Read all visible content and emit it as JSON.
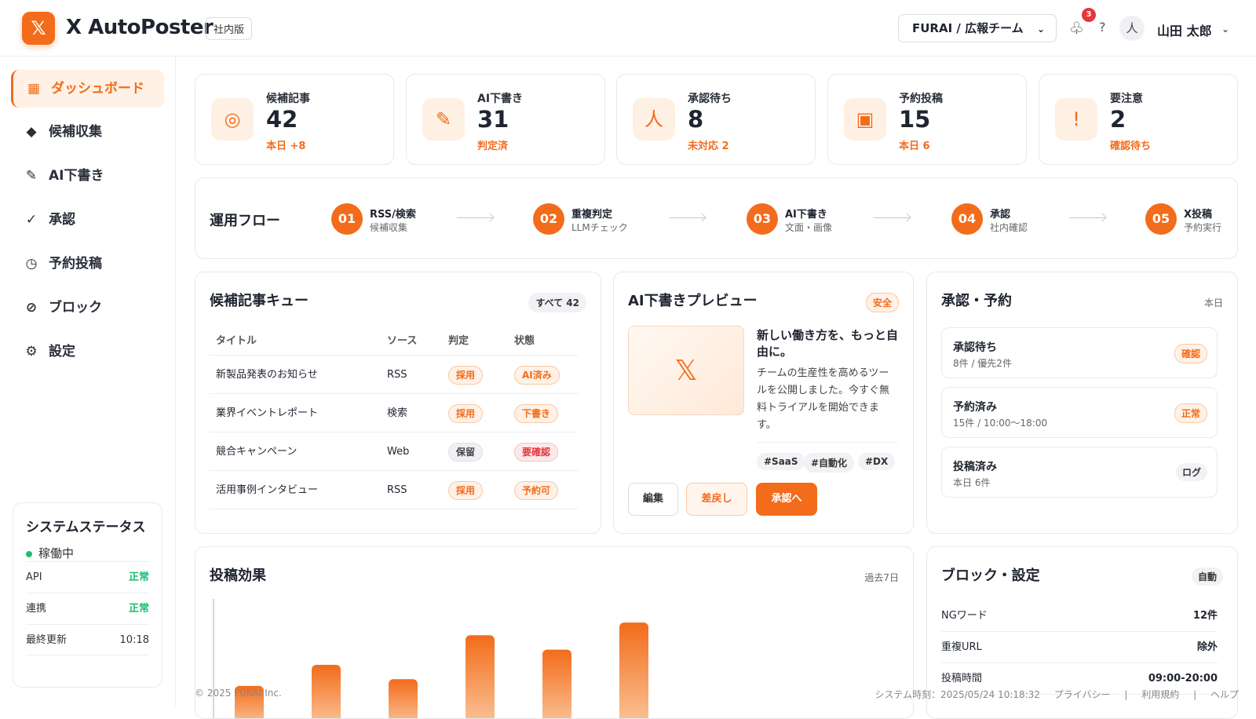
{
  "header": {
    "logo_glyph": "𝕏",
    "app_name": "X AutoPoster",
    "edition": "社内版",
    "team": "FURAI / 広報チーム",
    "notification_count": "3",
    "help": "?",
    "avatar": "人",
    "user": "山田 太郎"
  },
  "sidebar": {
    "items": [
      {
        "icon": "▦",
        "label": "ダッシュボード"
      },
      {
        "icon": "◆",
        "label": "候補収集"
      },
      {
        "icon": "✎",
        "label": "AI下書き"
      },
      {
        "icon": "✓",
        "label": "承認"
      },
      {
        "icon": "◷",
        "label": "予約投稿"
      },
      {
        "icon": "⊘",
        "label": "ブロック"
      },
      {
        "icon": "⚙",
        "label": "設定"
      }
    ],
    "status": {
      "title": "システムステータス",
      "state": "稼働中",
      "rows": [
        {
          "label": "API",
          "value": "正常"
        },
        {
          "label": "連携",
          "value": "正常"
        },
        {
          "label": "最終更新",
          "value": "10:18"
        }
      ]
    }
  },
  "stats": [
    {
      "icon": "◎",
      "label": "候補記事",
      "value": "42",
      "sub": "本日 +8"
    },
    {
      "icon": "✎",
      "label": "AI下書き",
      "value": "31",
      "sub": "判定済"
    },
    {
      "icon": "人",
      "label": "承認待ち",
      "value": "8",
      "sub": "未対応 2"
    },
    {
      "icon": "▣",
      "label": "予約投稿",
      "value": "15",
      "sub": "本日 6"
    },
    {
      "icon": "!",
      "label": "要注意",
      "value": "2",
      "sub": "確認待ち"
    }
  ],
  "flow": {
    "title": "運用フロー",
    "steps": [
      {
        "num": "01",
        "title": "RSS/検索",
        "sub": "候補収集"
      },
      {
        "num": "02",
        "title": "重複判定",
        "sub": "LLMチェック"
      },
      {
        "num": "03",
        "title": "AI下書き",
        "sub": "文面・画像"
      },
      {
        "num": "04",
        "title": "承認",
        "sub": "社内確認"
      },
      {
        "num": "05",
        "title": "X投稿",
        "sub": "予約実行"
      }
    ]
  },
  "queue": {
    "title": "候補記事キュー",
    "badge": "すべて 42",
    "columns": [
      "タイトル",
      "ソース",
      "判定",
      "状態"
    ],
    "rows": [
      {
        "title": "新製品発表のお知らせ",
        "source": "RSS",
        "judge": "採用",
        "state": "AI済み"
      },
      {
        "title": "業界イベントレポート",
        "source": "検索",
        "judge": "採用",
        "state": "下書き"
      },
      {
        "title": "競合キャンペーン",
        "source": "Web",
        "judge": "保留",
        "state": "要確認"
      },
      {
        "title": "活用事例インタビュー",
        "source": "RSS",
        "judge": "採用",
        "state": "予約可"
      }
    ]
  },
  "preview": {
    "title": "AI下書きプレビュー",
    "badge": "安全",
    "image_glyph": "𝕏",
    "post_title": "新しい働き方を、もっと自由に。",
    "post_body": "チームの生産性を高めるツールを公開しました。今すぐ無料トライアルを開始できます。",
    "hashtags": [
      "#SaaS",
      "#自動化",
      "#DX"
    ],
    "buttons": {
      "edit": "編集",
      "return": "差戻し",
      "approve": "承認へ"
    }
  },
  "approval": {
    "title": "承認・予約",
    "note": "本日",
    "items": [
      {
        "title": "承認待ち",
        "sub": "8件 / 優先2件",
        "badge": "確認"
      },
      {
        "title": "予約済み",
        "sub": "15件 / 10:00〜18:00",
        "badge": "正常"
      },
      {
        "title": "投稿済み",
        "sub": "本日 6件",
        "badge": "ログ"
      }
    ]
  },
  "effects": {
    "title": "投稿効果",
    "period": "過去7日"
  },
  "chart_data": {
    "type": "bar",
    "values": [
      40,
      65,
      48,
      100,
      83,
      115
    ],
    "ylim": [
      0,
      130
    ],
    "grid": false,
    "color": "#f26c1b"
  },
  "block": {
    "title": "ブロック・設定",
    "badge": "自動",
    "rows": [
      {
        "label": "NGワード",
        "value": "12件"
      },
      {
        "label": "重複URL",
        "value": "除外"
      },
      {
        "label": "投稿時間",
        "value": "09:00-20:00"
      }
    ]
  },
  "footer": {
    "copyright": "© 2025 FURAI Inc.",
    "system_time": "システム時刻：2025/05/24 10:18:32",
    "privacy": "プライバシー",
    "terms": "利用規約",
    "help": "ヘルプ"
  },
  "colors": {
    "accent": "#f26c1b",
    "ok": "#1dbd72",
    "alert": "#e5363c"
  }
}
